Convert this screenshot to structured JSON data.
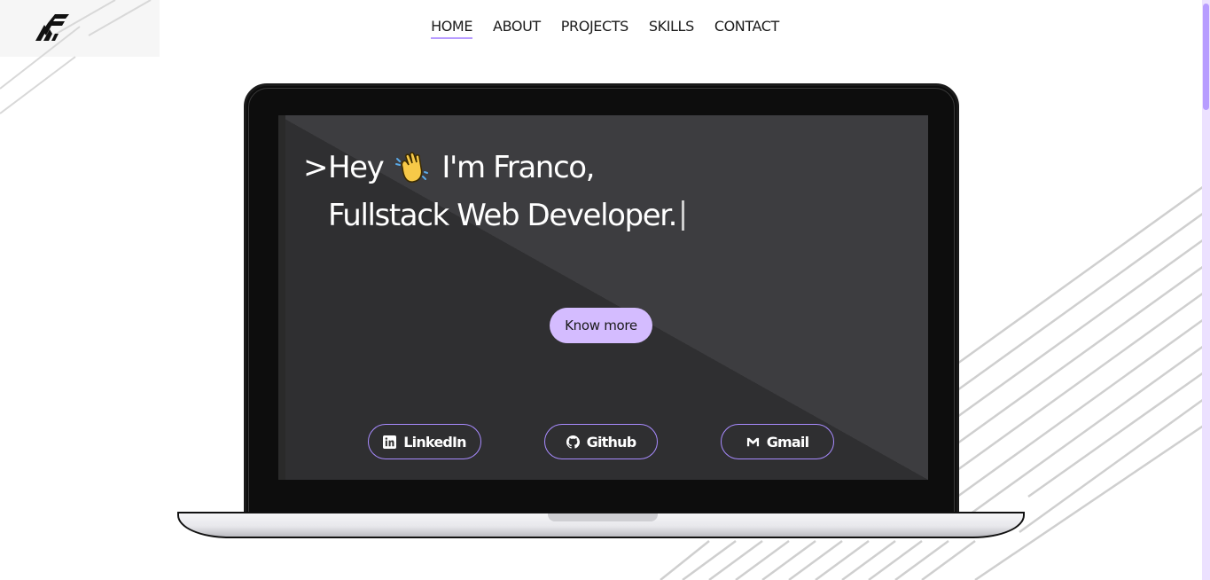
{
  "nav": {
    "items": [
      {
        "label": "HOME",
        "active": true
      },
      {
        "label": "ABOUT",
        "active": false
      },
      {
        "label": "PROJECTS",
        "active": false
      },
      {
        "label": "SKILLS",
        "active": false
      },
      {
        "label": "CONTACT",
        "active": false
      }
    ]
  },
  "logo": {
    "icon": "af-monogram-logo"
  },
  "hero": {
    "prompt": ">",
    "greeting": "Hey",
    "emoji": "waving-hand-icon",
    "intro": "I'm Franco,",
    "role": "Fullstack Web Developer.",
    "cta_label": "Know more"
  },
  "social": {
    "linkedin": {
      "label": "LinkedIn",
      "icon": "linkedin-icon"
    },
    "github": {
      "label": "Github",
      "icon": "github-icon"
    },
    "gmail": {
      "label": "Gmail",
      "icon": "gmail-icon"
    }
  },
  "colors": {
    "accent": "#b79cff",
    "button_bg": "#d4bcff",
    "screen_dark": "#2f2f31",
    "screen_light": "#3d3d40",
    "bezel": "#0d0d0d"
  }
}
